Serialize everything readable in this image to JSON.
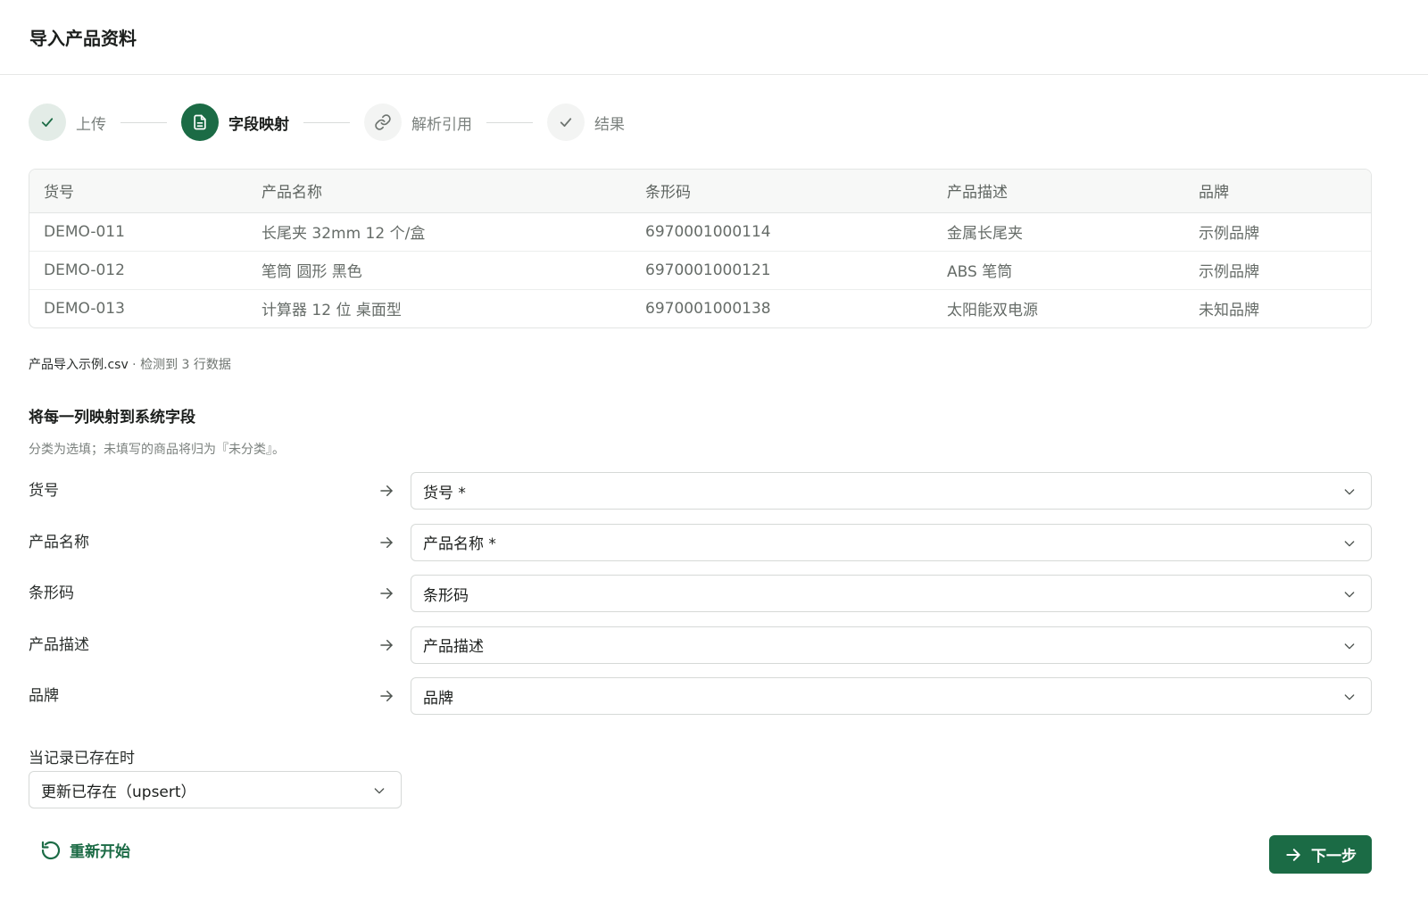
{
  "header": {
    "title": "导入产品资料"
  },
  "steps": [
    {
      "label": "上传",
      "state": "done",
      "icon": "check-icon"
    },
    {
      "label": "字段映射",
      "state": "active",
      "icon": "document-icon"
    },
    {
      "label": "解析引用",
      "state": "pending",
      "icon": "link-icon"
    },
    {
      "label": "结果",
      "state": "pending",
      "icon": "check-icon"
    }
  ],
  "preview": {
    "headers": [
      "货号",
      "产品名称",
      "条形码",
      "产品描述",
      "品牌"
    ],
    "rows": [
      [
        "DEMO-011",
        "长尾夹 32mm 12 个/盒",
        "6970001000114",
        "金属长尾夹",
        "示例品牌"
      ],
      [
        "DEMO-012",
        "笔筒 圆形 黑色",
        "6970001000121",
        "ABS 笔筒",
        "示例品牌"
      ],
      [
        "DEMO-013",
        "计算器 12 位 桌面型",
        "6970001000138",
        "太阳能双电源",
        "未知品牌"
      ]
    ]
  },
  "file": {
    "name": "产品导入示例.csv",
    "summary": " · 检测到 3 行数据"
  },
  "mapping": {
    "title": "将每一列映射到系统字段",
    "hint": "分类为选填；未填写的商品将归为『未分类』。",
    "rows": [
      {
        "source": "货号",
        "target": "货号 *"
      },
      {
        "source": "产品名称",
        "target": "产品名称 *"
      },
      {
        "source": "条形码",
        "target": "条形码"
      },
      {
        "source": "产品描述",
        "target": "产品描述"
      },
      {
        "source": "品牌",
        "target": "品牌"
      }
    ]
  },
  "existing": {
    "label": "当记录已存在时",
    "value": "更新已存在（upsert）"
  },
  "actions": {
    "restart_label": "重新开始",
    "next_label": "下一步"
  },
  "colors": {
    "primary": "#1b6b45",
    "done_bg": "#e3ece7",
    "border": "#d6d9d7"
  }
}
